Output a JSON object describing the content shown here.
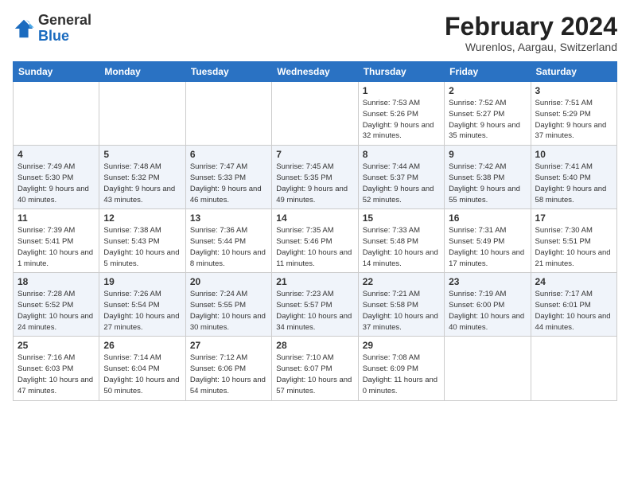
{
  "header": {
    "logo_general": "General",
    "logo_blue": "Blue",
    "title": "February 2024",
    "subtitle": "Wurenlos, Aargau, Switzerland"
  },
  "calendar": {
    "days_of_week": [
      "Sunday",
      "Monday",
      "Tuesday",
      "Wednesday",
      "Thursday",
      "Friday",
      "Saturday"
    ],
    "weeks": [
      [
        {
          "day": "",
          "info": ""
        },
        {
          "day": "",
          "info": ""
        },
        {
          "day": "",
          "info": ""
        },
        {
          "day": "",
          "info": ""
        },
        {
          "day": "1",
          "info": "Sunrise: 7:53 AM\nSunset: 5:26 PM\nDaylight: 9 hours and 32 minutes."
        },
        {
          "day": "2",
          "info": "Sunrise: 7:52 AM\nSunset: 5:27 PM\nDaylight: 9 hours and 35 minutes."
        },
        {
          "day": "3",
          "info": "Sunrise: 7:51 AM\nSunset: 5:29 PM\nDaylight: 9 hours and 37 minutes."
        }
      ],
      [
        {
          "day": "4",
          "info": "Sunrise: 7:49 AM\nSunset: 5:30 PM\nDaylight: 9 hours and 40 minutes."
        },
        {
          "day": "5",
          "info": "Sunrise: 7:48 AM\nSunset: 5:32 PM\nDaylight: 9 hours and 43 minutes."
        },
        {
          "day": "6",
          "info": "Sunrise: 7:47 AM\nSunset: 5:33 PM\nDaylight: 9 hours and 46 minutes."
        },
        {
          "day": "7",
          "info": "Sunrise: 7:45 AM\nSunset: 5:35 PM\nDaylight: 9 hours and 49 minutes."
        },
        {
          "day": "8",
          "info": "Sunrise: 7:44 AM\nSunset: 5:37 PM\nDaylight: 9 hours and 52 minutes."
        },
        {
          "day": "9",
          "info": "Sunrise: 7:42 AM\nSunset: 5:38 PM\nDaylight: 9 hours and 55 minutes."
        },
        {
          "day": "10",
          "info": "Sunrise: 7:41 AM\nSunset: 5:40 PM\nDaylight: 9 hours and 58 minutes."
        }
      ],
      [
        {
          "day": "11",
          "info": "Sunrise: 7:39 AM\nSunset: 5:41 PM\nDaylight: 10 hours and 1 minute."
        },
        {
          "day": "12",
          "info": "Sunrise: 7:38 AM\nSunset: 5:43 PM\nDaylight: 10 hours and 5 minutes."
        },
        {
          "day": "13",
          "info": "Sunrise: 7:36 AM\nSunset: 5:44 PM\nDaylight: 10 hours and 8 minutes."
        },
        {
          "day": "14",
          "info": "Sunrise: 7:35 AM\nSunset: 5:46 PM\nDaylight: 10 hours and 11 minutes."
        },
        {
          "day": "15",
          "info": "Sunrise: 7:33 AM\nSunset: 5:48 PM\nDaylight: 10 hours and 14 minutes."
        },
        {
          "day": "16",
          "info": "Sunrise: 7:31 AM\nSunset: 5:49 PM\nDaylight: 10 hours and 17 minutes."
        },
        {
          "day": "17",
          "info": "Sunrise: 7:30 AM\nSunset: 5:51 PM\nDaylight: 10 hours and 21 minutes."
        }
      ],
      [
        {
          "day": "18",
          "info": "Sunrise: 7:28 AM\nSunset: 5:52 PM\nDaylight: 10 hours and 24 minutes."
        },
        {
          "day": "19",
          "info": "Sunrise: 7:26 AM\nSunset: 5:54 PM\nDaylight: 10 hours and 27 minutes."
        },
        {
          "day": "20",
          "info": "Sunrise: 7:24 AM\nSunset: 5:55 PM\nDaylight: 10 hours and 30 minutes."
        },
        {
          "day": "21",
          "info": "Sunrise: 7:23 AM\nSunset: 5:57 PM\nDaylight: 10 hours and 34 minutes."
        },
        {
          "day": "22",
          "info": "Sunrise: 7:21 AM\nSunset: 5:58 PM\nDaylight: 10 hours and 37 minutes."
        },
        {
          "day": "23",
          "info": "Sunrise: 7:19 AM\nSunset: 6:00 PM\nDaylight: 10 hours and 40 minutes."
        },
        {
          "day": "24",
          "info": "Sunrise: 7:17 AM\nSunset: 6:01 PM\nDaylight: 10 hours and 44 minutes."
        }
      ],
      [
        {
          "day": "25",
          "info": "Sunrise: 7:16 AM\nSunset: 6:03 PM\nDaylight: 10 hours and 47 minutes."
        },
        {
          "day": "26",
          "info": "Sunrise: 7:14 AM\nSunset: 6:04 PM\nDaylight: 10 hours and 50 minutes."
        },
        {
          "day": "27",
          "info": "Sunrise: 7:12 AM\nSunset: 6:06 PM\nDaylight: 10 hours and 54 minutes."
        },
        {
          "day": "28",
          "info": "Sunrise: 7:10 AM\nSunset: 6:07 PM\nDaylight: 10 hours and 57 minutes."
        },
        {
          "day": "29",
          "info": "Sunrise: 7:08 AM\nSunset: 6:09 PM\nDaylight: 11 hours and 0 minutes."
        },
        {
          "day": "",
          "info": ""
        },
        {
          "day": "",
          "info": ""
        }
      ]
    ]
  }
}
